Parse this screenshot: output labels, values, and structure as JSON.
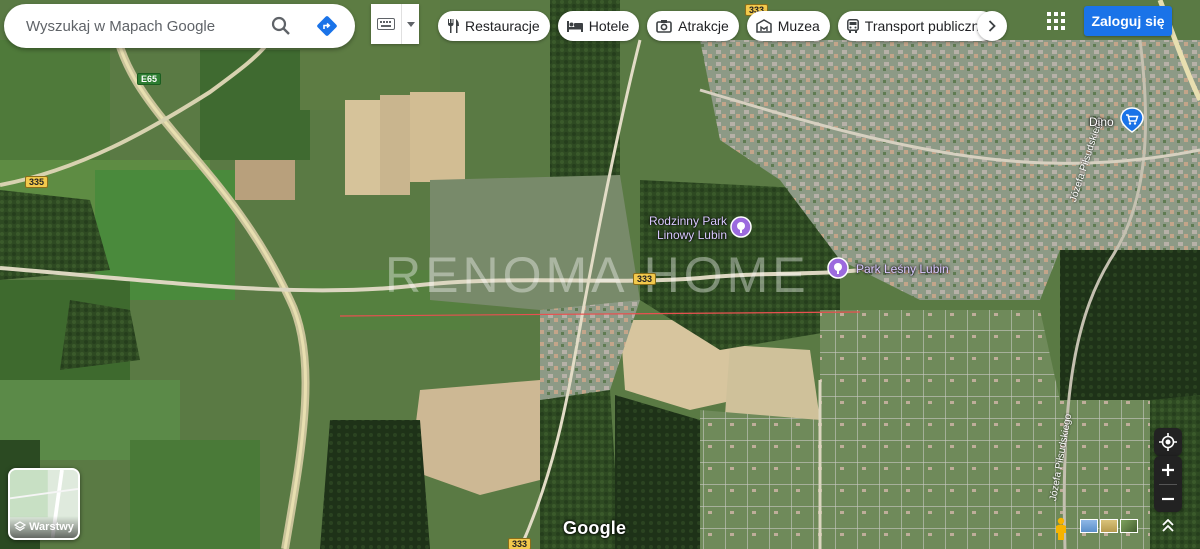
{
  "search": {
    "placeholder": "Wyszukaj w Mapach Google"
  },
  "chips": [
    {
      "label": "Restauracje",
      "icon": "fork-knife-icon"
    },
    {
      "label": "Hotele",
      "icon": "bed-icon"
    },
    {
      "label": "Atrakcje",
      "icon": "camera-icon"
    },
    {
      "label": "Muzea",
      "icon": "museum-icon"
    },
    {
      "label": "Transport publiczny",
      "icon": "bus-icon"
    }
  ],
  "login_label": "Zaloguj się",
  "layers_label": "Warstwy",
  "google_logo": "Google",
  "watermark": "RENOMA HOME",
  "pois": {
    "park_linowy": "Rodzinny Park Linowy Lubin",
    "park_lesny": "Park Leśny Lubin",
    "dino": "Dino"
  },
  "road_numbers": {
    "r335": "335",
    "r333": "333",
    "e65": "E65"
  },
  "streets": {
    "pilsudskiego_top": "Józefa Piłsudskiego",
    "pilsudskiego_bottom": "Józefa Piłsudskiego"
  },
  "colors": {
    "login": "#1a73e8",
    "poi": "#9c6ade",
    "dino_pin": "#1a73e8",
    "road_badge": "#f2c94c"
  }
}
